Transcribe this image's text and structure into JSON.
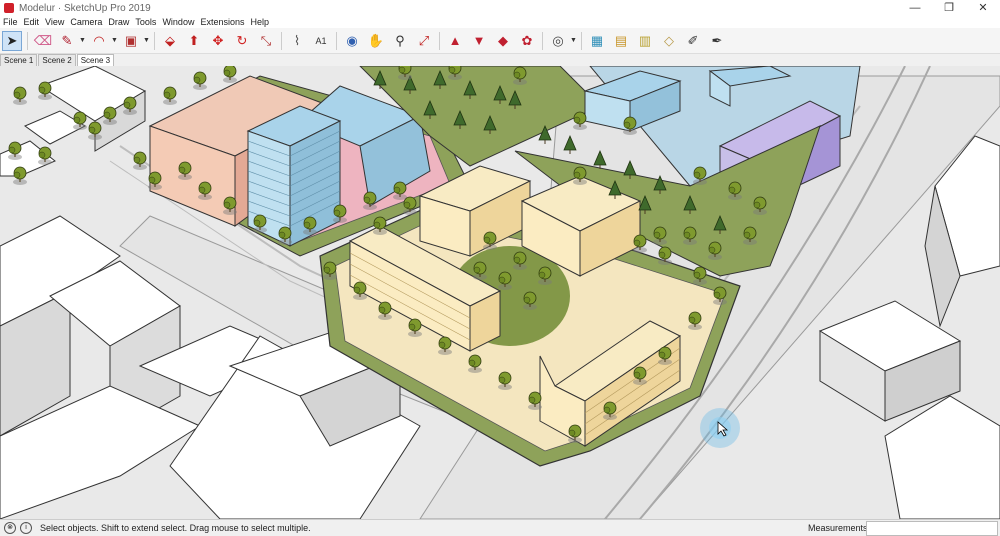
{
  "window": {
    "title": "Modelur · SketchUp Pro 2019",
    "controls": [
      "—",
      "❐",
      "✕"
    ]
  },
  "menu": [
    "File",
    "Edit",
    "View",
    "Camera",
    "Draw",
    "Tools",
    "Window",
    "Extensions",
    "Help"
  ],
  "toolbar": {
    "tools": [
      {
        "name": "select-tool",
        "glyph": "➤",
        "selected": true
      },
      {
        "name": "eraser-tool",
        "glyph": "⌫"
      },
      {
        "name": "pencil-tool",
        "glyph": "✎"
      },
      {
        "name": "arc-tool",
        "glyph": "◠"
      },
      {
        "name": "rectangle-tool",
        "glyph": "▣"
      },
      {
        "name": "push-pull-tool",
        "glyph": "⬙"
      },
      {
        "name": "follow-me-tool",
        "glyph": "⬆"
      },
      {
        "name": "move-tool",
        "glyph": "✥"
      },
      {
        "name": "rotate-tool",
        "glyph": "↻"
      },
      {
        "name": "scale-tool",
        "glyph": "⤡"
      },
      {
        "name": "tape-measure-tool",
        "glyph": "📏"
      },
      {
        "name": "text-tool",
        "glyph": "A1"
      },
      {
        "name": "orbit-tool",
        "glyph": "◉"
      },
      {
        "name": "pan-tool",
        "glyph": "✋"
      },
      {
        "name": "zoom-tool",
        "glyph": "🔍"
      },
      {
        "name": "zoom-extents-tool",
        "glyph": "⤢"
      },
      {
        "name": "warehouse-tool",
        "glyph": "▲"
      },
      {
        "name": "extension-warehouse-tool",
        "glyph": "▼"
      },
      {
        "name": "send-to-layout-tool",
        "glyph": "◆"
      },
      {
        "name": "extension-manager-tool",
        "glyph": "✿"
      },
      {
        "name": "account-tool",
        "glyph": "👤"
      },
      {
        "name": "modelur-block-tool",
        "glyph": "▦"
      },
      {
        "name": "modelur-building-tool",
        "glyph": "▤"
      },
      {
        "name": "modelur-stack-tool",
        "glyph": "▥"
      },
      {
        "name": "modelur-plot-tool",
        "glyph": "◇"
      },
      {
        "name": "eyedropper-tool",
        "glyph": "⚲"
      },
      {
        "name": "paint-tool",
        "glyph": "✒"
      }
    ]
  },
  "scenes": [
    "Scene 1",
    "Scene 2",
    "Scene 3"
  ],
  "status": {
    "message": "Select objects. Shift to extend select. Drag mouse to select multiple.",
    "measurements_label": "Measurements",
    "measurements_value": ""
  },
  "colors": {
    "ground": "#e9e9e9",
    "road": "#e3e3e3",
    "grass": "#8ea25a",
    "plot_sand": "#f4e6bf",
    "building_cream": "#f7e4b3",
    "building_salmon": "#edbba8",
    "building_blue": "#a9d3ea",
    "building_purple": "#b3a3dd",
    "pink_plot": "#eeb4c0",
    "water": "#b9d6e6"
  }
}
